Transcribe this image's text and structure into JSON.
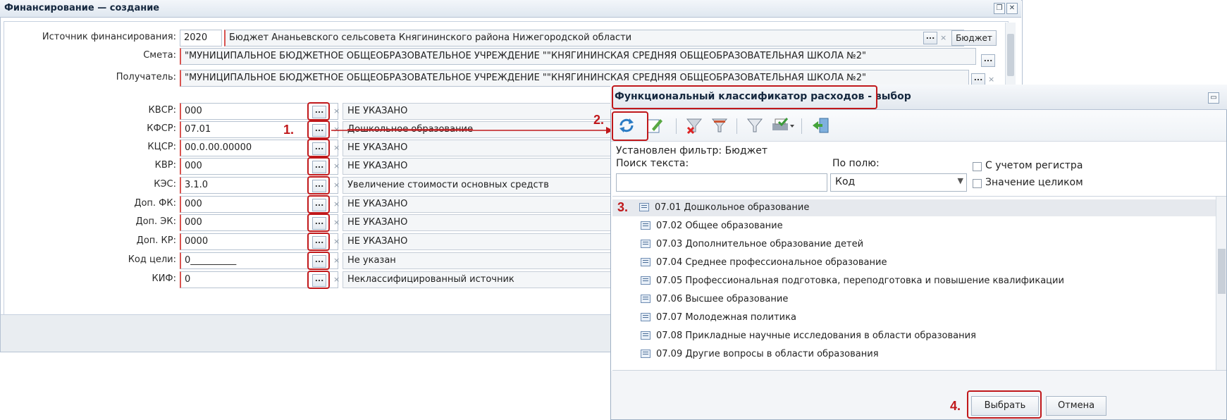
{
  "main_window": {
    "title": "Финансирование — создание",
    "source_label": "Источник финансирования:",
    "source_year": "2020",
    "source_value": "Бюджет Ананьевского сельсовета Княгининского района Нижегородской области",
    "source_button": "Бюджет",
    "smeta_label": "Смета:",
    "smeta_value": "\"МУНИЦИПАЛЬНОЕ БЮДЖЕТНОЕ ОБЩЕОБРАЗОВАТЕЛЬНОЕ УЧРЕЖДЕНИЕ \"\"КНЯГИНИНСКАЯ СРЕДНЯЯ ОБЩЕОБРАЗОВАТЕЛЬНАЯ ШКОЛА №2\"",
    "recipient_label": "Получатель:",
    "recipient_value": "\"МУНИЦИПАЛЬНОЕ БЮДЖЕТНОЕ ОБЩЕОБРАЗОВАТЕЛЬНОЕ УЧРЕЖДЕНИЕ \"\"КНЯГИНИНСКАЯ СРЕДНЯЯ ОБЩЕОБРАЗОВАТЕЛЬНАЯ ШКОЛА №2\"",
    "lookup_button": "...",
    "clear_icon": "×",
    "rows": [
      {
        "label": "КВСР:",
        "code": "000",
        "name": "НЕ УКАЗАНО"
      },
      {
        "label": "КФСР:",
        "code": "07.01",
        "name": "Дошкольное образование"
      },
      {
        "label": "КЦСР:",
        "code": "00.0.00.00000",
        "name": "НЕ УКАЗАНО"
      },
      {
        "label": "КВР:",
        "code": "000",
        "name": "НЕ УКАЗАНО"
      },
      {
        "label": "КЭС:",
        "code": "3.1.0",
        "name": "Увеличение стоимости основных средств"
      },
      {
        "label": "Доп. ФК:",
        "code": "000",
        "name": "НЕ УКАЗАНО"
      },
      {
        "label": "Доп. ЭК:",
        "code": "000",
        "name": "НЕ УКАЗАНО"
      },
      {
        "label": "Доп. КР:",
        "code": "0000",
        "name": "НЕ УКАЗАНО"
      },
      {
        "label": "Код цели:",
        "code": "0__________",
        "name": "Не указан"
      },
      {
        "label": "КИФ:",
        "code": "0",
        "name": "Неклассифицированный источник"
      }
    ]
  },
  "steps": {
    "s1": "1.",
    "s2": "2.",
    "s3": "3.",
    "s4": "4."
  },
  "dialog": {
    "title": "Функциональный классификатор расходов - выбор",
    "filter_text": "Установлен фильтр: Бюджет",
    "search_label": "Поиск текста:",
    "search_value": "",
    "field_label": "По полю:",
    "field_value": "Код",
    "case_label": "С учетом регистра",
    "whole_label": "Значение целиком",
    "items": [
      "07.01 Дошкольное образование",
      "07.02 Общее образование",
      "07.03 Дополнительное образование детей",
      "07.04 Среднее профессиональное образование",
      "07.05 Профессиональная подготовка, переподготовка и повышение квалификации",
      "07.06 Высшее образование",
      "07.07 Молодежная политика",
      "07.08 Прикладные научные исследования в области образования",
      "07.09 Другие вопросы в области образования"
    ],
    "select_button": "Выбрать",
    "cancel_button": "Отмена"
  },
  "colors": {
    "accent_red": "#c0181b",
    "selected_row": "#e6e9ee"
  }
}
